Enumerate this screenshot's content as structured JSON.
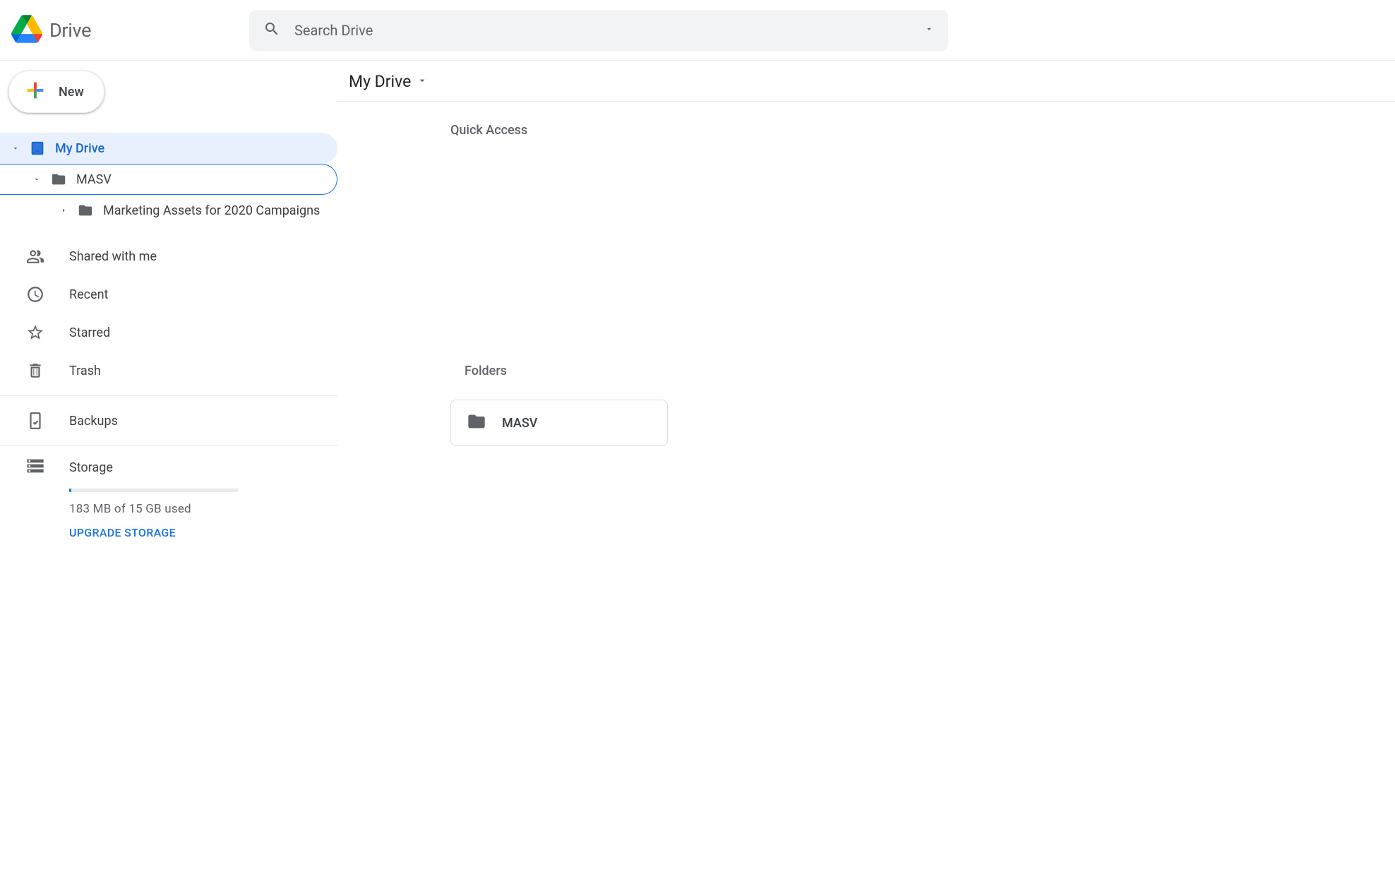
{
  "header": {
    "app_name": "Drive",
    "search_placeholder": "Search Drive"
  },
  "sidebar": {
    "new_label": "New",
    "tree": {
      "root": "My Drive",
      "level1": "MASV",
      "level2": "Marketing Assets for 2020 Campaigns"
    },
    "nav": {
      "shared": "Shared with me",
      "recent": "Recent",
      "starred": "Starred",
      "trash": "Trash",
      "backups": "Backups"
    },
    "storage": {
      "label": "Storage",
      "used_text": "183 MB of 15 GB used",
      "upgrade": "UPGRADE STORAGE"
    }
  },
  "main": {
    "breadcrumb": "My Drive",
    "quick_access_label": "Quick Access",
    "folders_label": "Folders",
    "folders": [
      {
        "name": "MASV"
      }
    ]
  }
}
